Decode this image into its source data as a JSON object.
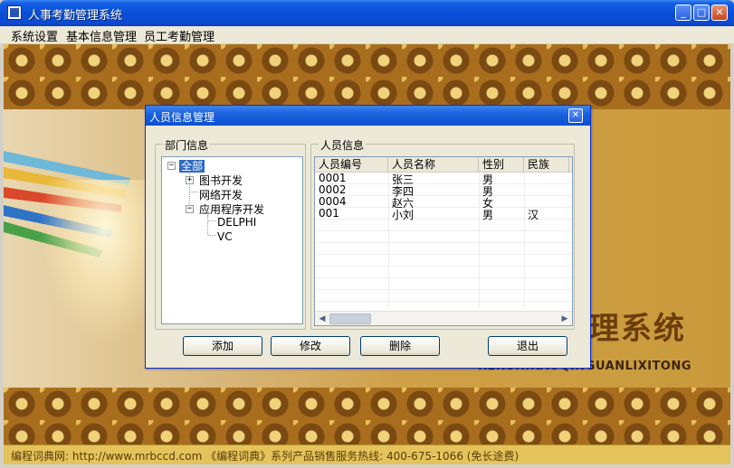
{
  "window": {
    "title": "人事考勤管理系统",
    "controls": {
      "minimize": "_",
      "maximize": "□",
      "close": "✕"
    }
  },
  "menu": {
    "system": "系统设置",
    "basic": "基本信息管理",
    "attendance": "员工考勤管理"
  },
  "background": {
    "logo_cn": "理系统",
    "logo_pinyin": "RENSHIKAOQINGUANLIXITONG",
    "footer": "编程词典网: http://www.mrbccd.com  《编程词典》系列产品销售服务热线: 400-675-1066 (免长途费)"
  },
  "dialog": {
    "title": "人员信息管理",
    "close": "✕",
    "dept_group_label": "部门信息",
    "staff_group_label": "人员信息",
    "tree": {
      "root": "全部",
      "books": "图书开发",
      "network": "网络开发",
      "app": "应用程序开发",
      "delphi": "DELPHI",
      "vc": "VC"
    },
    "tree_expander": {
      "collapse": "−",
      "expand": "+"
    },
    "columns": [
      "人员编号",
      "人员名称",
      "性别",
      "民族"
    ],
    "rows": [
      [
        "0001",
        "张三",
        "男",
        ""
      ],
      [
        "0002",
        "李四",
        "男",
        ""
      ],
      [
        "0004",
        "赵六",
        "女",
        ""
      ],
      [
        "001",
        "小刘",
        "男",
        "汉"
      ]
    ],
    "scroll": {
      "left": "◀",
      "right": "▶"
    },
    "buttons": {
      "add": "添加",
      "modify": "修改",
      "delete": "删除",
      "exit": "退出"
    }
  },
  "colors": {
    "titlebar": "#0a4fd8",
    "selection": "#316ac5",
    "dialog_bg": "#ece9d8"
  }
}
